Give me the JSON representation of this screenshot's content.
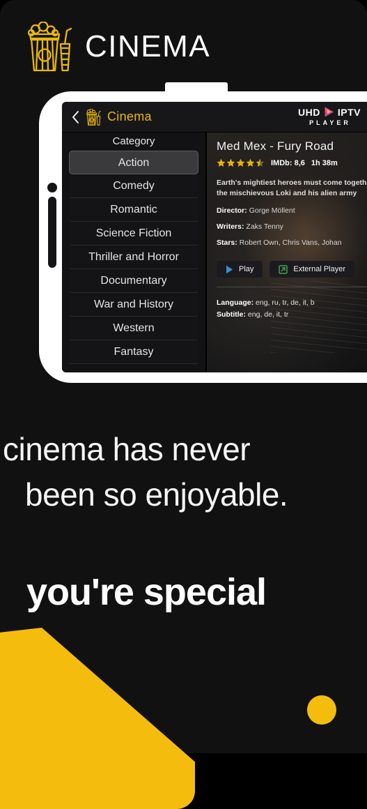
{
  "brand": {
    "name": "CINEMA",
    "icon": "popcorn-icon"
  },
  "phone_app": {
    "app_bar": {
      "back_icon": "chevron-left-icon",
      "logo_icon": "popcorn-icon",
      "title": "Cinema",
      "player_logo": {
        "left": "UHD",
        "right": "IPTV",
        "sub": "PLAYER",
        "play_icon": "play-triangle-icon",
        "accent": "#e8548f"
      }
    },
    "category_panel": {
      "header": "Category",
      "items": [
        {
          "label": "Action",
          "selected": true
        },
        {
          "label": "Comedy",
          "selected": false
        },
        {
          "label": "Romantic",
          "selected": false
        },
        {
          "label": "Science Fiction",
          "selected": false
        },
        {
          "label": "Thriller and Horror",
          "selected": false
        },
        {
          "label": "Documentary",
          "selected": false
        },
        {
          "label": "War and History",
          "selected": false
        },
        {
          "label": "Western",
          "selected": false
        },
        {
          "label": "Fantasy",
          "selected": false
        }
      ]
    },
    "detail_panel": {
      "title": "Med Mex - Fury Road",
      "stars_filled": 4,
      "stars_half": 1,
      "stars_total": 5,
      "imdb": "IMDb: 8,6",
      "runtime": "1h 38m",
      "synopsis_line1": "Earth's mightiest heroes must come together",
      "synopsis_line2": "the mischievous Loki and his alien army",
      "director_label": "Director:",
      "director_value": "Gorge Möllent",
      "writers_label": "Writers:",
      "writers_value": "Zaks Tenny",
      "stars_label": "Stars:",
      "stars_value": "Robert Own, Chris Vans, Johan",
      "play_button": "Play",
      "external_button": "External Player",
      "play_icon": "play-triangle-icon",
      "external_icon": "external-link-icon",
      "language_label": "Language:",
      "language_value": "eng, ru, tr, de, it, b",
      "subtitle_label": "Subtitle:",
      "subtitle_value": "eng, de, it, tr"
    }
  },
  "marketing": {
    "tagline_line1": "cinema has never",
    "tagline_line2": "been so enjoyable.",
    "headline": "you're special"
  },
  "colors": {
    "accent_yellow": "#f4bd0e",
    "title_yellow": "#e9b909",
    "background": "#111112",
    "play_blue": "#3d8ccf",
    "external_green": "#3fa34d"
  }
}
